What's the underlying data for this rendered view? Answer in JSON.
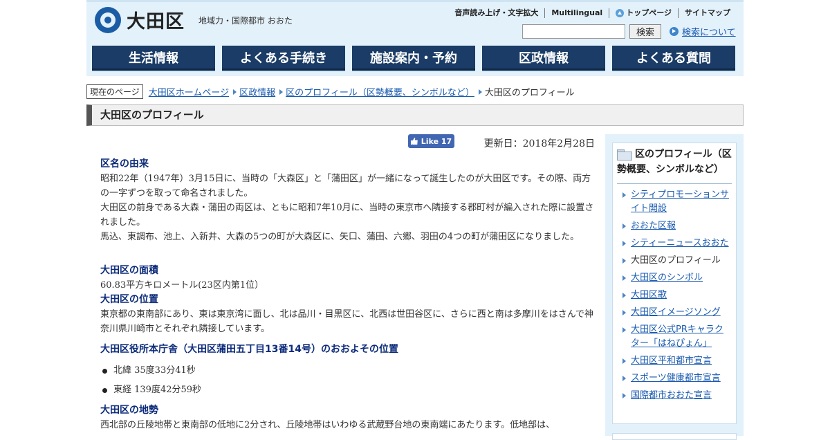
{
  "header": {
    "logo_text": "大田区",
    "logo_subtitle": "地域力・国際都市 おおた",
    "util": {
      "read_aloud": "音声読み上げ・文字拡大",
      "multilingual": "Multilingual",
      "top_page": "トップページ",
      "sitemap": "サイトマップ"
    },
    "search": {
      "placeholder": "",
      "button": "検索",
      "about": "検索について"
    },
    "nav": [
      "生活情報",
      "よくある手続き",
      "施設案内・予約",
      "区政情報",
      "よくある質問"
    ]
  },
  "breadcrumb": {
    "here_label": "現在のページ",
    "items": [
      "大田区ホームページ",
      "区政情報",
      "区のプロフィール（区勢概要、シンボルなど）"
    ],
    "current": "大田区のプロフィール"
  },
  "page_title": "大田区のプロフィール",
  "main": {
    "like_label": "Like 17",
    "updated": "更新日：2018年2月28日",
    "sections": [
      {
        "heading": "区名の由来",
        "paragraphs": [
          "昭和22年（1947年）3月15日に、当時の「大森区」と「蒲田区」が一緒になって誕生したのが大田区です。その際、両方の一字ずつを取って命名されました。",
          "大田区の前身である大森・蒲田の両区は、ともに昭和7年10月に、当時の東京市へ隣接する郡町村が編入された際に設置されました。",
          "馬込、東調布、池上、入新井、大森の5つの町が大森区に、矢口、蒲田、六郷、羽田の4つの町が蒲田区になりました。"
        ]
      },
      {
        "heading": "大田区の面積",
        "paragraphs": [
          "60.83平方キロメートル(23区内第1位）"
        ]
      },
      {
        "heading": "大田区の位置",
        "paragraphs": [
          "東京都の東南部にあり、東は東京湾に面し、北は品川・目黒区に、北西は世田谷区に、さらに西と南は多摩川をはさんで神奈川県川崎市とそれぞれ隣接しています。"
        ]
      },
      {
        "heading": "大田区役所本庁舎（大田区蒲田五丁目13番14号）のおおよその位置",
        "list": [
          "北緯 35度33分41秒",
          "東経 139度42分59秒"
        ]
      },
      {
        "heading": "大田区の地勢",
        "paragraphs": [
          "西北部の丘陵地帯と東南部の低地に2分され、丘陵地帯はいわゆる武蔵野台地の東南端にあたります。低地部は、"
        ]
      }
    ]
  },
  "sidebar": {
    "heading": "区のプロフィール（区勢概要、シンボルなど）",
    "items": [
      {
        "label": "シティプロモーションサイト開設",
        "link": true
      },
      {
        "label": "おおた区報",
        "link": true
      },
      {
        "label": "シティーニュースおおた",
        "link": true
      },
      {
        "label": "大田区のプロフィール",
        "link": false
      },
      {
        "label": "大田区のシンボル",
        "link": true
      },
      {
        "label": "大田区歌",
        "link": true
      },
      {
        "label": "大田区イメージソング",
        "link": true
      },
      {
        "label": "大田区公式PRキャラクター「はねぴょん」",
        "link": true
      },
      {
        "label": "大田区平和都市宣言",
        "link": true
      },
      {
        "label": "スポーツ健康都市宣言",
        "link": true
      },
      {
        "label": "国際都市おおた宣言",
        "link": true
      }
    ]
  },
  "colors": {
    "nav_bg": "#1a3c66",
    "header_bg": "#e3f1fb",
    "heading": "#0b2a7a",
    "link": "#1a5bb0",
    "facebook": "#4267b2"
  }
}
